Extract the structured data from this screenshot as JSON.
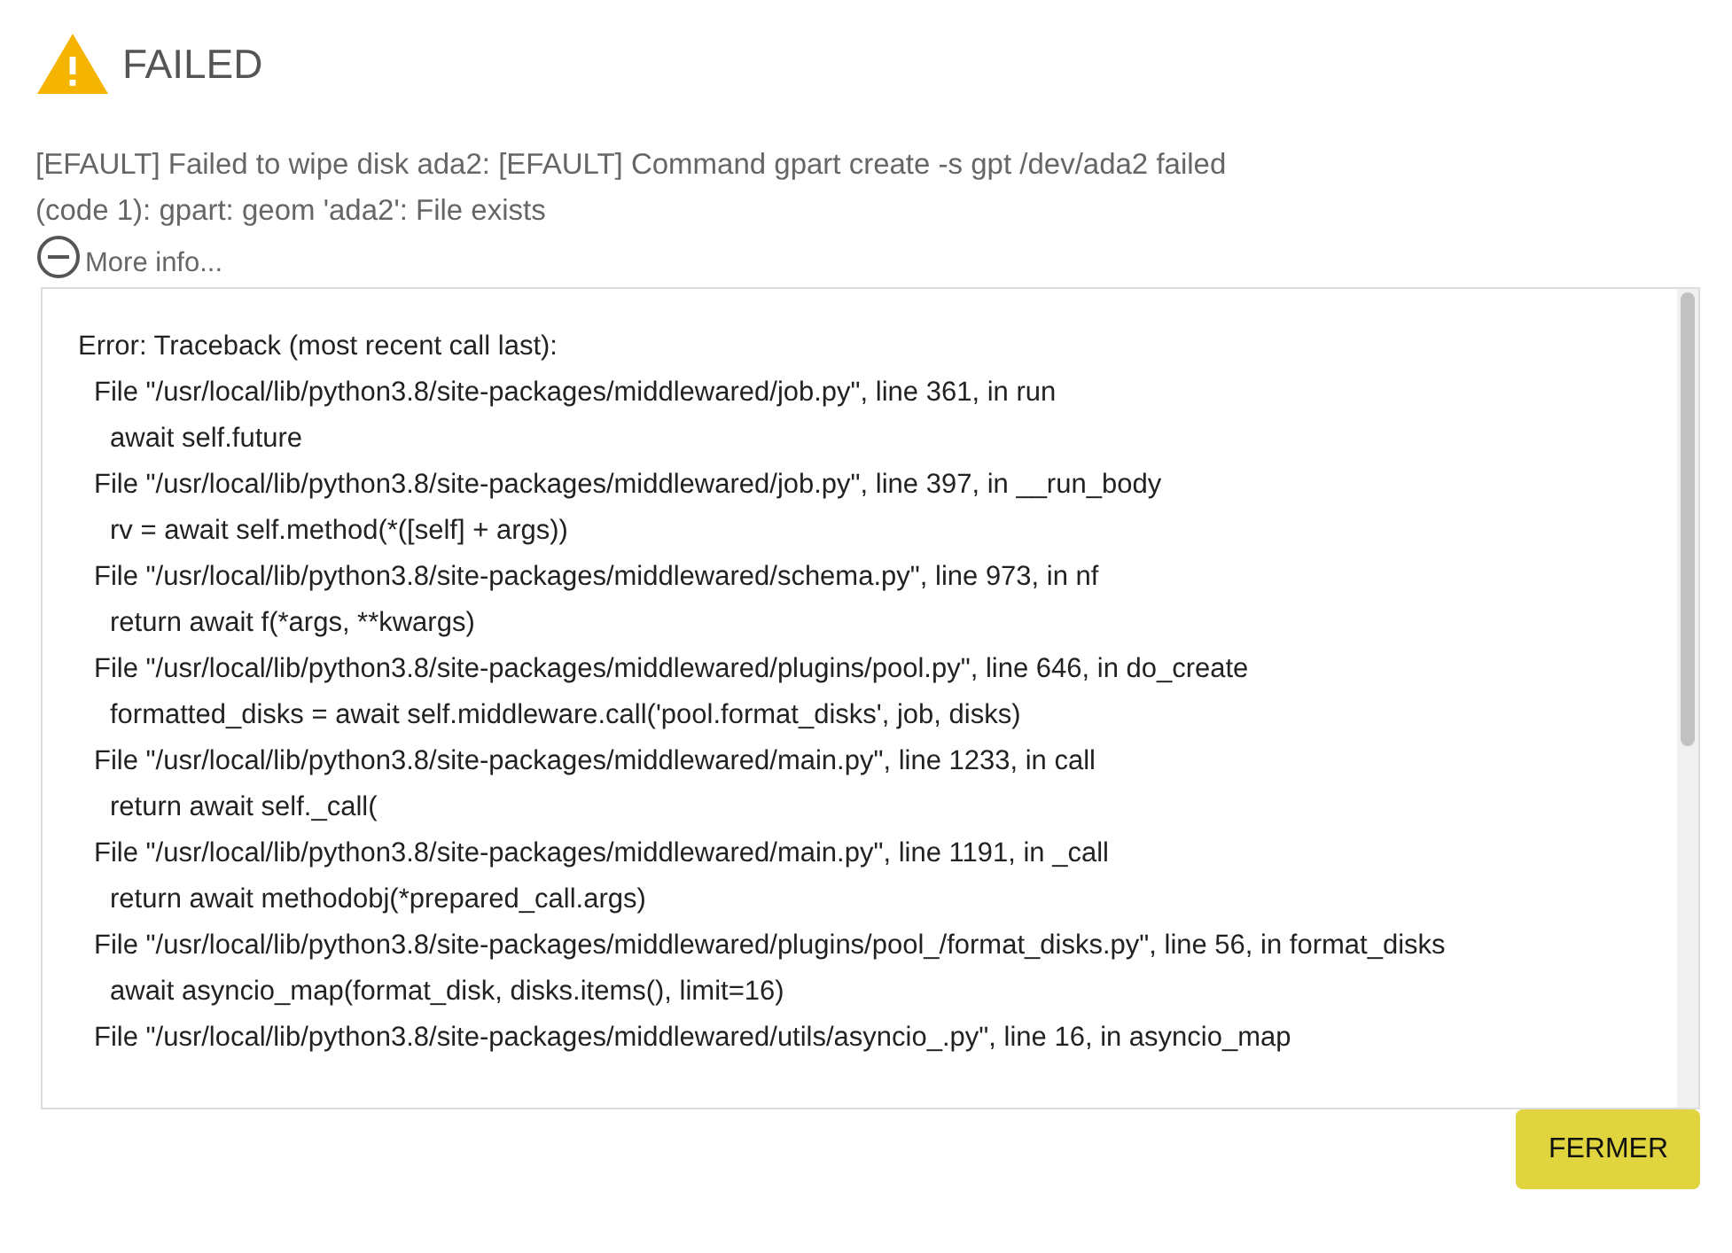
{
  "dialog": {
    "title": "FAILED",
    "message": "[EFAULT] Failed to wipe disk ada2: [EFAULT] Command gpart create -s gpt /dev/ada2 failed (code 1): gpart: geom 'ada2': File exists",
    "more_info": {
      "label": "More info...",
      "expanded": true
    },
    "traceback": [
      {
        "kind": "header",
        "text": "Error: Traceback (most recent call last):"
      },
      {
        "kind": "file",
        "text": "File \"/usr/local/lib/python3.8/site-packages/middlewared/job.py\", line 361, in run"
      },
      {
        "kind": "code",
        "text": "await self.future"
      },
      {
        "kind": "file",
        "text": "File \"/usr/local/lib/python3.8/site-packages/middlewared/job.py\", line 397, in __run_body"
      },
      {
        "kind": "code",
        "text": "rv = await self.method(*([self] + args))"
      },
      {
        "kind": "file",
        "text": "File \"/usr/local/lib/python3.8/site-packages/middlewared/schema.py\", line 973, in nf"
      },
      {
        "kind": "code",
        "text": "return await f(*args, **kwargs)"
      },
      {
        "kind": "file",
        "text": "File \"/usr/local/lib/python3.8/site-packages/middlewared/plugins/pool.py\", line 646, in do_create"
      },
      {
        "kind": "code",
        "text": "formatted_disks = await self.middleware.call('pool.format_disks', job, disks)"
      },
      {
        "kind": "file",
        "text": "File \"/usr/local/lib/python3.8/site-packages/middlewared/main.py\", line 1233, in call"
      },
      {
        "kind": "code",
        "text": "return await self._call("
      },
      {
        "kind": "file",
        "text": "File \"/usr/local/lib/python3.8/site-packages/middlewared/main.py\", line 1191, in _call"
      },
      {
        "kind": "code",
        "text": "return await methodobj(*prepared_call.args)"
      },
      {
        "kind": "file",
        "text": "File \"/usr/local/lib/python3.8/site-packages/middlewared/plugins/pool_/format_disks.py\", line 56, in format_disks"
      },
      {
        "kind": "code",
        "text": "await asyncio_map(format_disk, disks.items(), limit=16)"
      },
      {
        "kind": "file",
        "text": "File \"/usr/local/lib/python3.8/site-packages/middlewared/utils/asyncio_.py\", line 16, in asyncio_map"
      }
    ],
    "buttons": [
      {
        "label": "FERMER"
      }
    ]
  }
}
